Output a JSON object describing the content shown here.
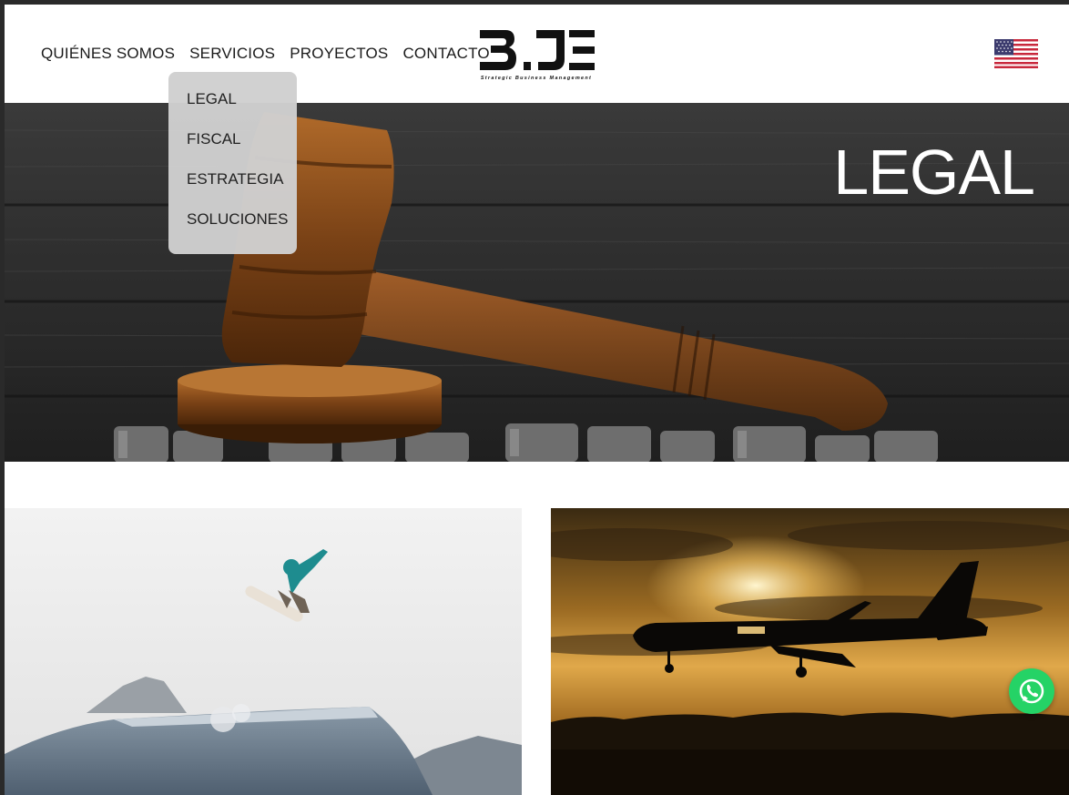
{
  "nav": {
    "items": [
      {
        "label": "QUIÉNES SOMOS"
      },
      {
        "label": "SERVICIOS"
      },
      {
        "label": "PROYECTOS"
      },
      {
        "label": "CONTACTO"
      }
    ]
  },
  "logo": {
    "text": "BJE",
    "tagline": "Strategic Business Management"
  },
  "language": {
    "icon": "us-flag-icon"
  },
  "dropdown": {
    "items": [
      {
        "label": "LEGAL"
      },
      {
        "label": "FISCAL"
      },
      {
        "label": "ESTRATEGIA"
      },
      {
        "label": "SOLUCIONES"
      }
    ]
  },
  "hero": {
    "title": "LEGAL"
  },
  "cards": [
    {
      "image": "snowboarder-jump-image"
    },
    {
      "image": "airplane-sunset-image"
    }
  ],
  "whatsapp": {
    "icon": "whatsapp-icon",
    "color": "#25d366"
  },
  "colors": {
    "text": "#1a1a1a",
    "dropdown_bg": "#d0d0d0",
    "accent": "#25d366"
  }
}
